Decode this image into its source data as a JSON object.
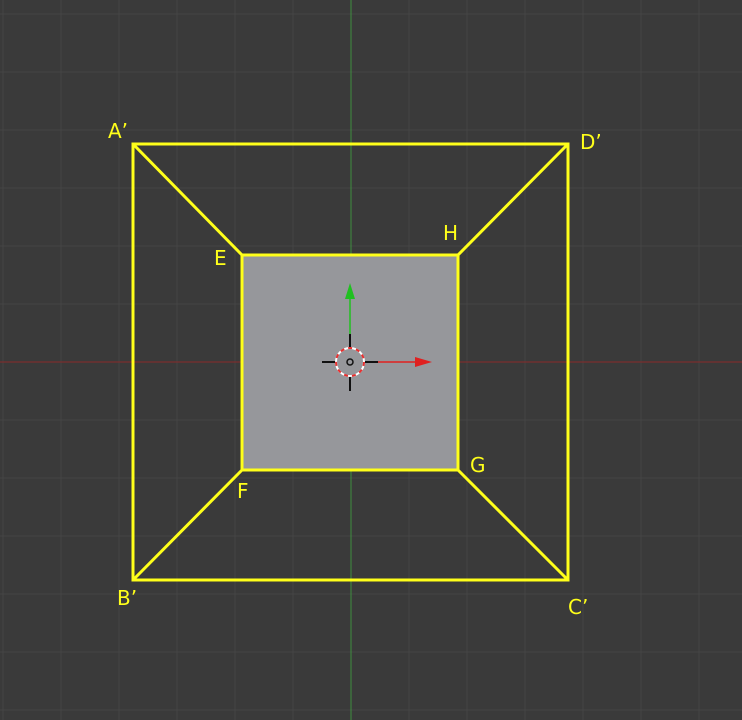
{
  "viewport": {
    "grid_visible": true,
    "colors": {
      "background": "#3a3a3a",
      "grid_line": "#444444",
      "x_axis": "#8a2a2a",
      "y_axis": "#3f8f3f",
      "selection": "#ffff1a",
      "face_fill": "#96979b",
      "gizmo_x": "#e02020",
      "gizmo_y": "#20c020",
      "cursor_ring_a": "#e83030",
      "cursor_ring_b": "#ffffff"
    }
  },
  "mesh": {
    "outer_face_selected": true,
    "inner_face_shaded": true
  },
  "vertex_labels": {
    "a_prime": "A’",
    "b_prime": "B’",
    "c_prime": "C’",
    "d_prime": "D’",
    "e": "E",
    "f": "F",
    "g": "G",
    "h": "H"
  },
  "icons": {
    "origin": "3d-cursor-icon",
    "gizmo": "transform-gizmo-icon"
  }
}
